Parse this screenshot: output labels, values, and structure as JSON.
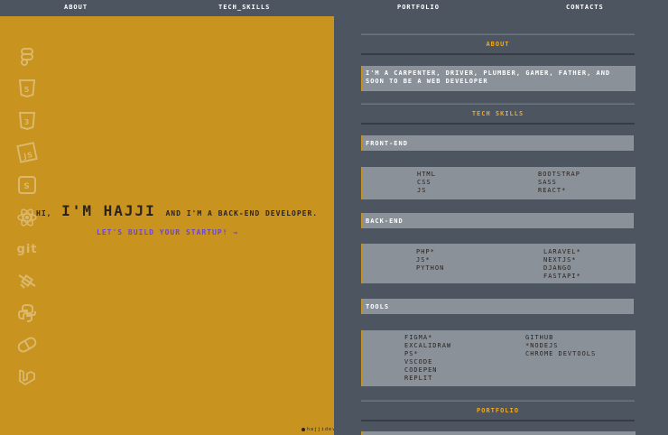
{
  "nav": {
    "about": "About",
    "tech_skills": "Tech_Skills",
    "portfolio": "Portfolio",
    "contacts": "Contacts"
  },
  "sidebar_icons": [
    "figma-icon",
    "html5-icon",
    "css3-icon",
    "javascript-icon",
    "sass-icon",
    "react-icon",
    "git-icon",
    "satellite-icon",
    "python-icon",
    "pill-icon",
    "laravel-icon"
  ],
  "hero": {
    "greeting": "Hi,",
    "name": "I'm Hajji",
    "role": "and I'm a back-end developer.",
    "cta": "Let's build your startup! →"
  },
  "credit": "hajjidev",
  "about": {
    "title": "About",
    "text": "I'm a carpenter, driver, plumber, gamer, father, and soon to be a web developer"
  },
  "tech_skills": {
    "title": "Tech skills",
    "frontend": {
      "label": "Front-end",
      "left": [
        "HTML",
        "CSS",
        "JS"
      ],
      "right": [
        "Bootstrap",
        "SASS",
        "React*"
      ]
    },
    "backend": {
      "label": "Back-end",
      "left": [
        "PHP*",
        "JS*",
        "Python"
      ],
      "right": [
        "Laravel*",
        "NextJS*",
        "Django",
        "FastAPI*"
      ]
    },
    "tools": {
      "label": "Tools",
      "left": [
        "Figma*",
        "Excalidraw",
        "PS*",
        "VSCode",
        "CodePen",
        "Replit"
      ],
      "right": [
        "GitHub",
        "*NodeJS",
        "Chrome DevTools"
      ]
    }
  },
  "portfolio": {
    "title": "Portfolio"
  },
  "colors": {
    "left_panel": "#c8931f",
    "right_panel": "#4d5660",
    "accent": "#f2a81c",
    "cta": "#6a46d6",
    "box": "#8a9199"
  }
}
